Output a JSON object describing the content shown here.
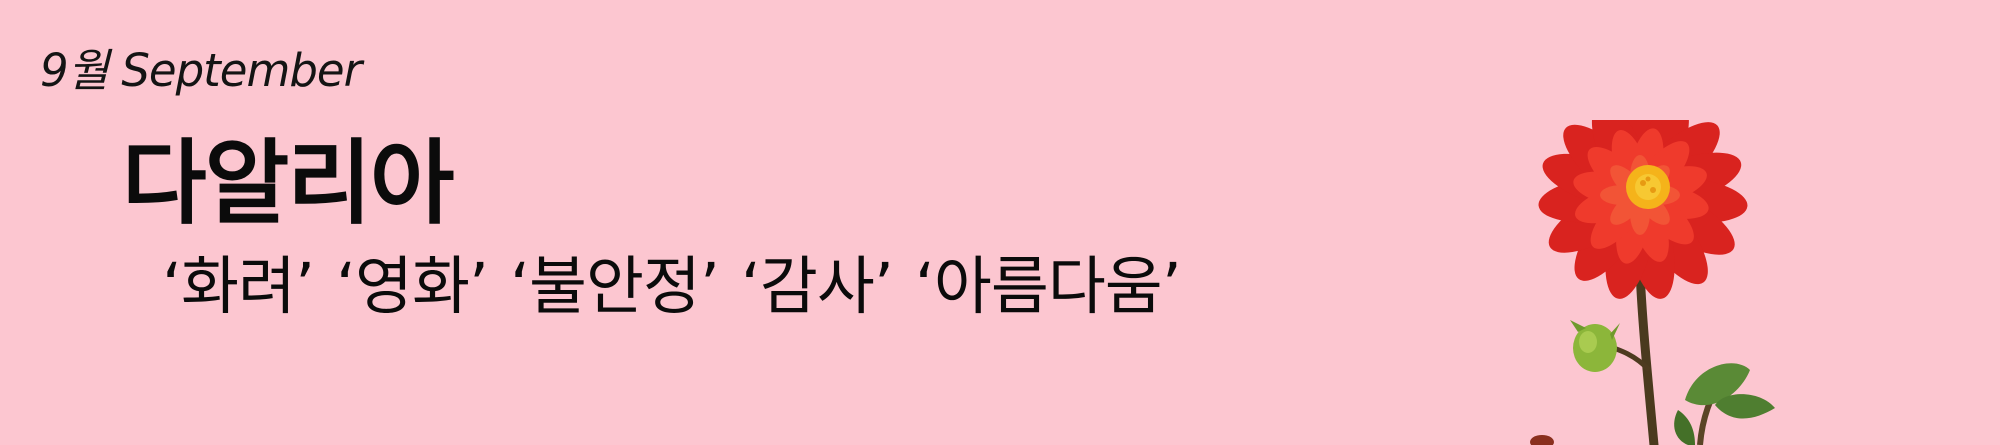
{
  "header": {
    "month": "9월 September"
  },
  "flower": {
    "name": "다알리아",
    "meanings": [
      "‘화려’",
      "‘영화’",
      "‘불안정’",
      "‘감사’",
      "‘아름다움’"
    ]
  },
  "illustration": {
    "icon": "dahlia-flower-icon",
    "petal_color": "#e02a25",
    "center_color": "#f5b31a",
    "stem_color": "#4a3a1e",
    "leaf_color": "#5a8a36"
  }
}
